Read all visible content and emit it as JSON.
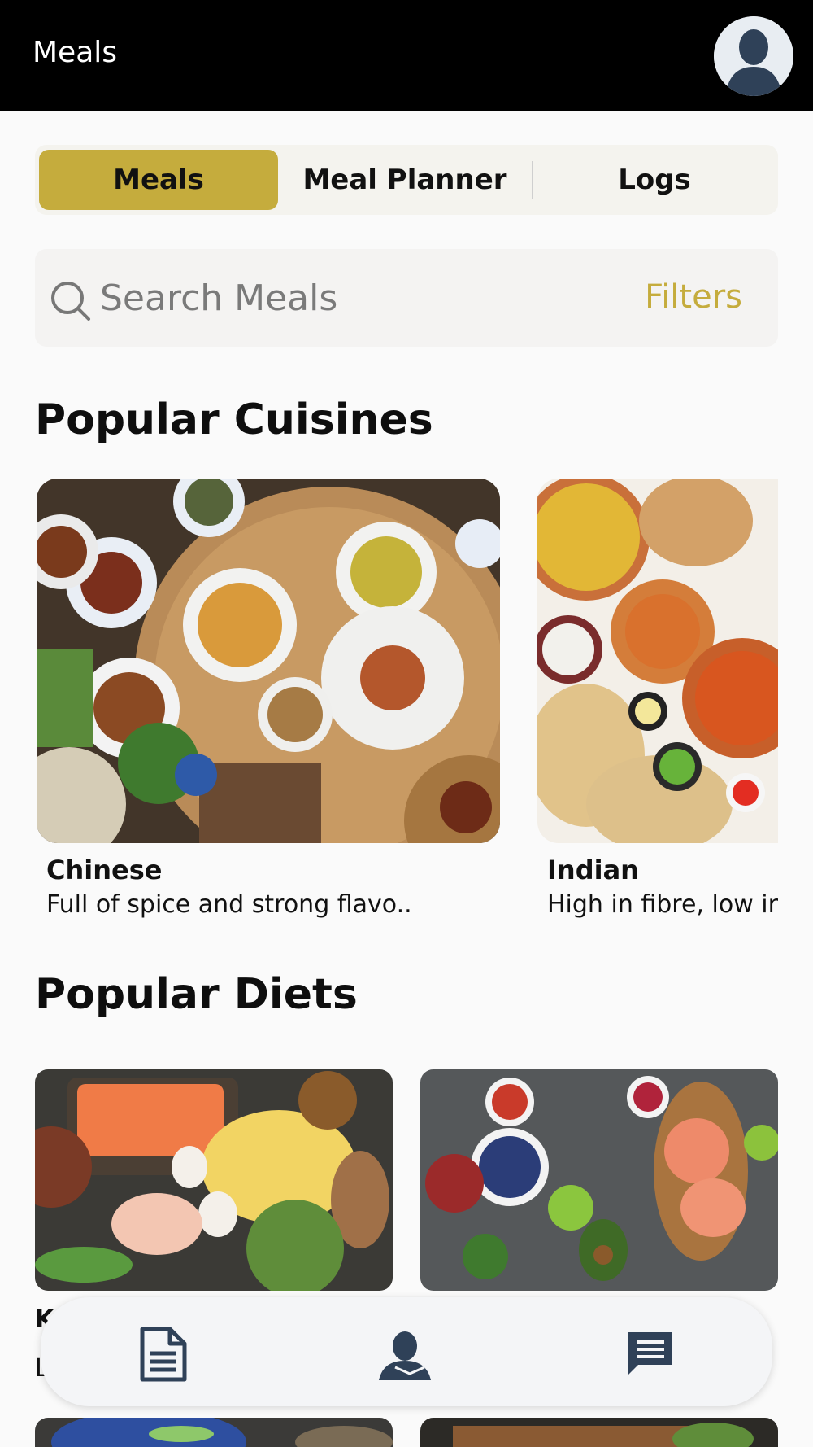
{
  "header": {
    "title": "Meals"
  },
  "tabs": [
    {
      "label": "Meals",
      "active": true
    },
    {
      "label": "Meal Planner",
      "active": false
    },
    {
      "label": "Logs",
      "active": false
    }
  ],
  "search": {
    "placeholder": "Search Meals",
    "filters_label": "Filters"
  },
  "sections": {
    "cuisines_title": "Popular Cuisines",
    "diets_title": "Popular Diets"
  },
  "cuisines": [
    {
      "title": "Chinese",
      "description": "Full of spice and strong flavo.."
    },
    {
      "title": "Indian",
      "description": "High in fibre, low in"
    }
  ],
  "diets": [
    {
      "title": "K",
      "description": "L"
    }
  ],
  "bottom_nav": [
    {
      "icon": "document-icon"
    },
    {
      "icon": "user-icon"
    },
    {
      "icon": "chat-icon"
    }
  ],
  "colors": {
    "accent": "#c5ac3d",
    "header_bg": "#000000",
    "background": "#fafafa"
  }
}
